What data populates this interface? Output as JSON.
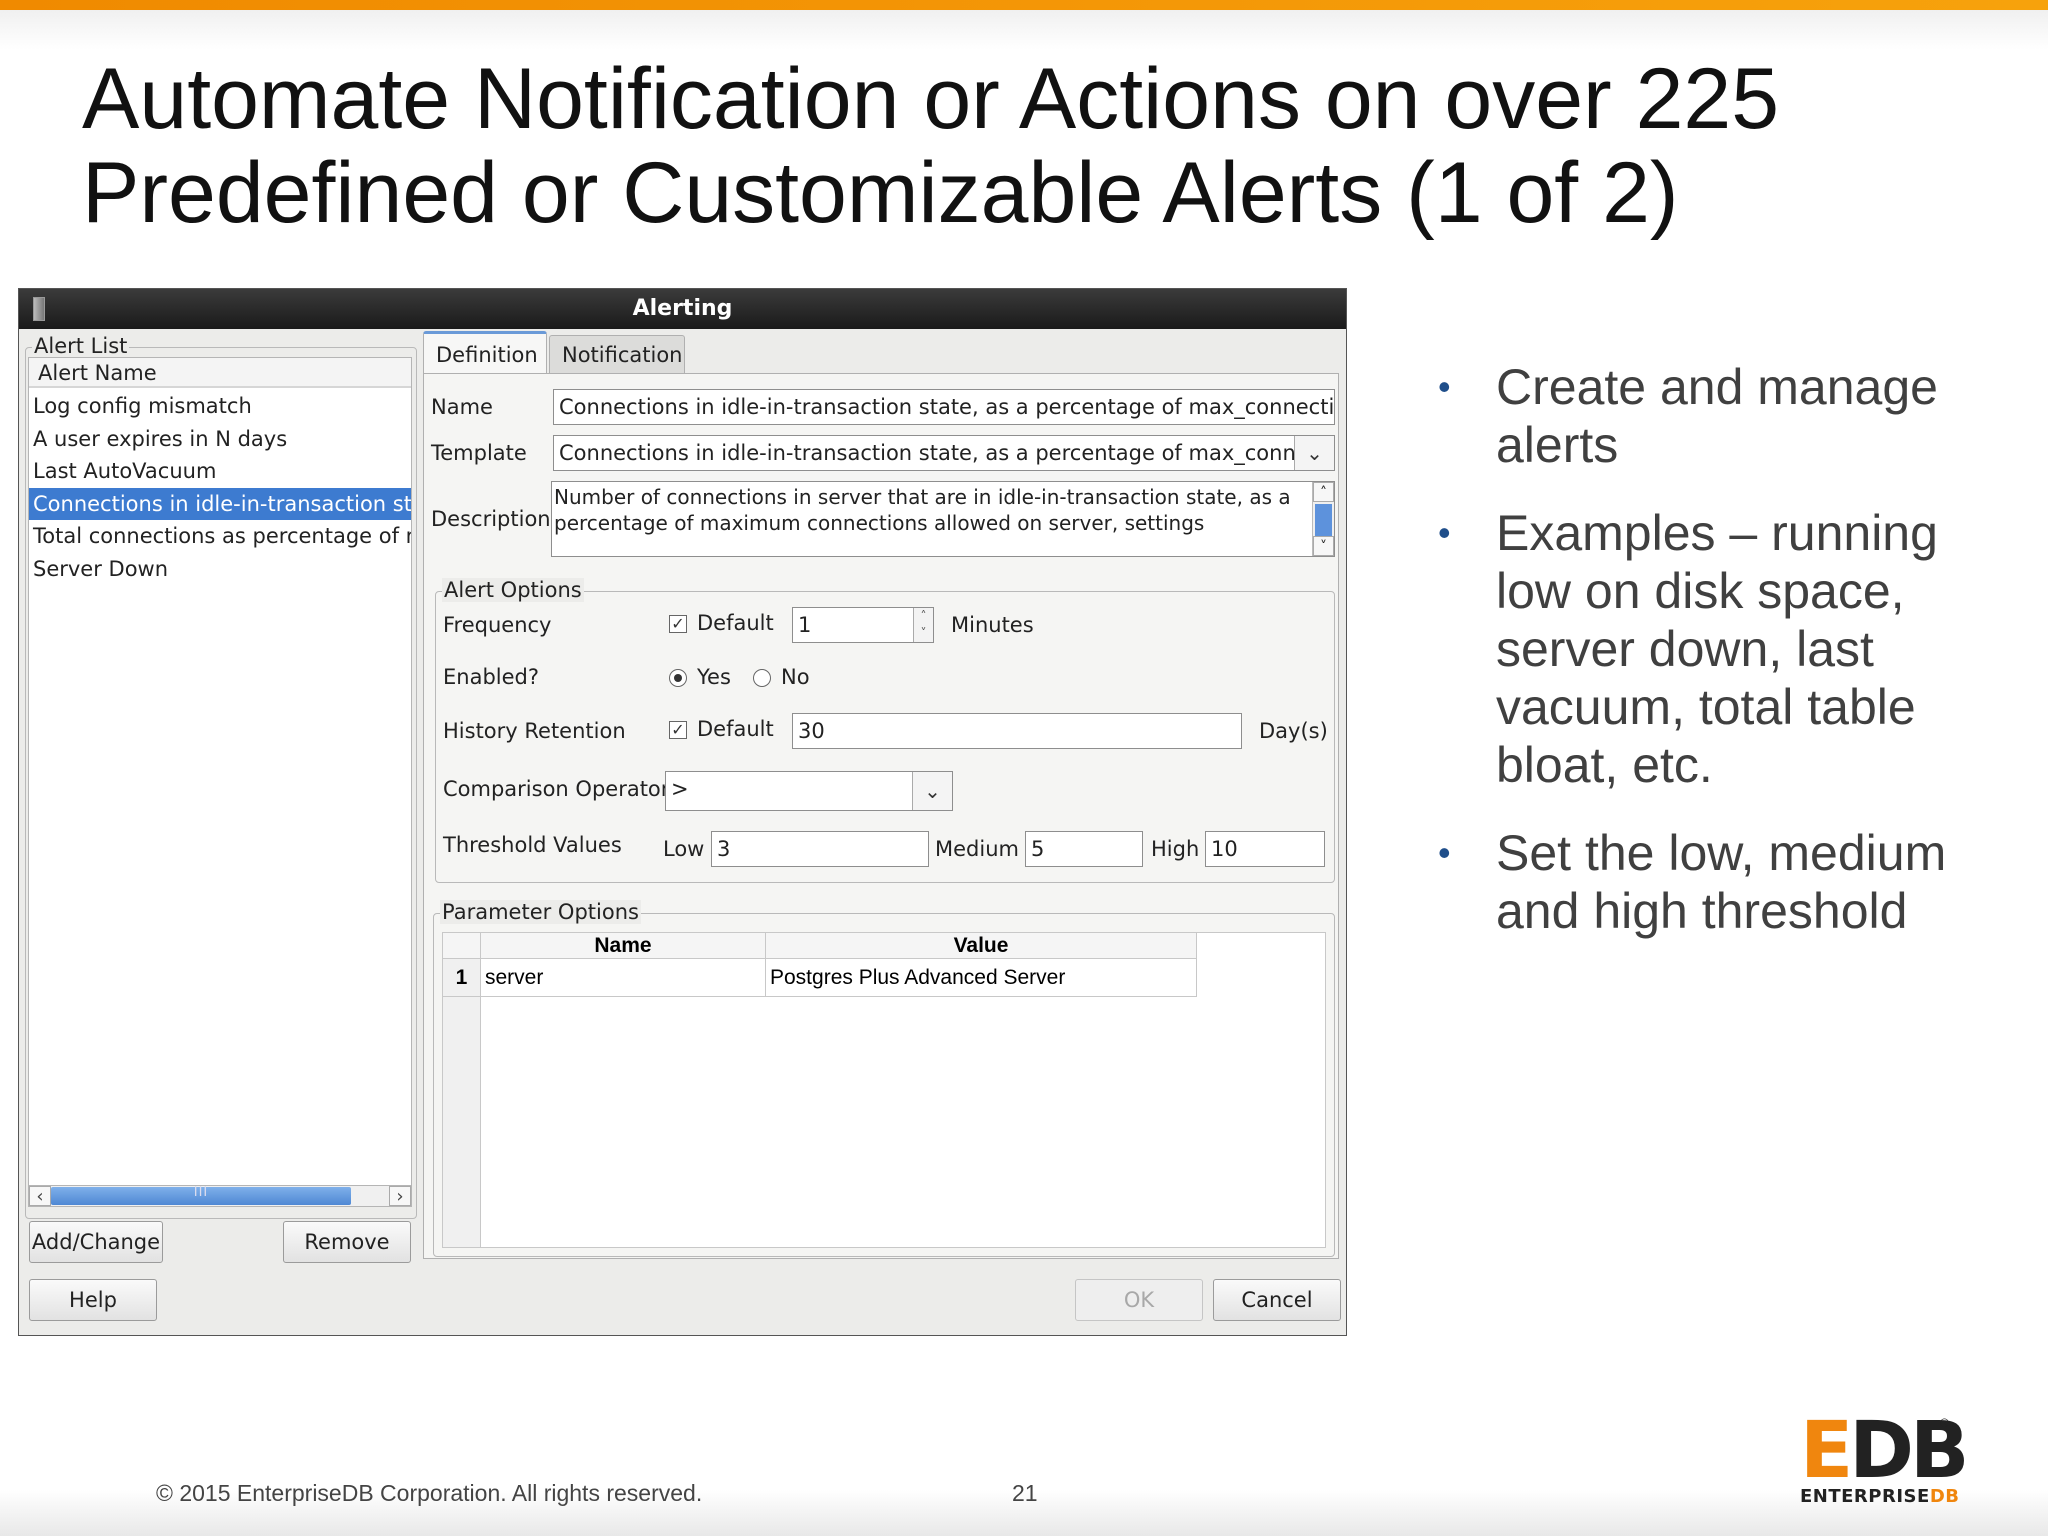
{
  "slide": {
    "title_line1": "Automate Notification or Actions on over 225",
    "title_line2": "Predefined or Customizable Alerts (1 of 2)",
    "bullets": [
      "Create and manage alerts",
      "Examples – running low on disk space, server down, last vacuum, total table bloat, etc.",
      "Set the low, medium and high threshold"
    ],
    "footer_copyright": "© 2015 EnterpriseDB Corporation. All rights reserved.",
    "page_number": "21",
    "logo_edb_e": "E",
    "logo_edb_db": "DB",
    "logo_enterprise": "ENTERPRISE",
    "logo_db_small": "DB",
    "logo_reg": "®"
  },
  "dialog": {
    "title": "Alerting",
    "close_glyph": "×",
    "alert_list": {
      "legend": "Alert List",
      "column_header": "Alert Name",
      "items": [
        "Log config mismatch",
        "A user expires in N days",
        "Last AutoVacuum",
        "Connections in idle-in-transaction state, as a percentage of max_connections",
        "Total connections as percentage of max_connections",
        "Server Down"
      ],
      "selected_index": 3,
      "scroll_grip": "III"
    },
    "buttons": {
      "add_change": "Add/Change",
      "remove": "Remove",
      "help": "Help",
      "ok": "OK",
      "cancel": "Cancel"
    },
    "tabs": [
      "Definition",
      "Notification"
    ],
    "active_tab": "Definition",
    "definition": {
      "name_label": "Name",
      "name_value": "Connections in idle-in-transaction state, as a percentage of max_connections",
      "template_label": "Template",
      "template_value": "Connections in idle-in-transaction state, as a percentage of max_connect",
      "description_label": "Description",
      "description_value": "Number of connections in server that are in idle-in-transaction state, as a percentage of maximum connections allowed on server, settings"
    },
    "alert_options": {
      "legend": "Alert Options",
      "frequency_label": "Frequency",
      "frequency_default_label": "Default",
      "frequency_default_checked": true,
      "frequency_value": "1",
      "frequency_unit": "Minutes",
      "enabled_label": "Enabled?",
      "enabled_yes": "Yes",
      "enabled_no": "No",
      "enabled_selected": "Yes",
      "history_label": "History Retention",
      "history_default_label": "Default",
      "history_default_checked": true,
      "history_value": "30",
      "history_unit": "Day(s)",
      "comparison_label": "Comparison Operator",
      "comparison_value": ">",
      "threshold_label": "Threshold Values",
      "low_label": "Low",
      "low_value": "3",
      "medium_label": "Medium",
      "medium_value": "5",
      "high_label": "High",
      "high_value": "10"
    },
    "parameter_options": {
      "legend": "Parameter Options",
      "columns": [
        "Name",
        "Value"
      ],
      "rows": [
        {
          "num": "1",
          "name": "server",
          "value": "Postgres Plus Advanced Server"
        }
      ]
    },
    "glyphs": {
      "chevron_down": "⌄",
      "check": "✓",
      "arrow_left": "‹",
      "arrow_right": "›",
      "arrow_up": "˄",
      "arrow_down": "˅"
    }
  }
}
